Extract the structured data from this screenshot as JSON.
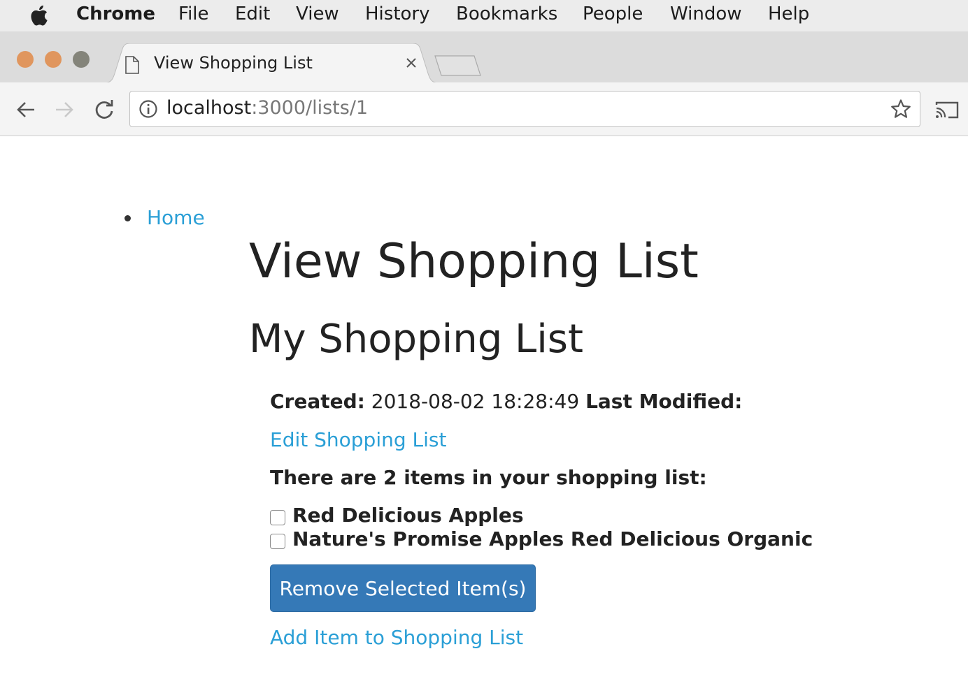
{
  "menubar": {
    "app_name": "Chrome",
    "items": [
      "File",
      "Edit",
      "View",
      "History",
      "Bookmarks",
      "People",
      "Window",
      "Help"
    ]
  },
  "browser": {
    "tab_title": "View Shopping List",
    "url_host": "localhost",
    "url_rest": ":3000/lists/1"
  },
  "page": {
    "nav": {
      "home": "Home"
    },
    "title": "View Shopping List",
    "list_name": "My Shopping List",
    "created_label": "Created:",
    "created_value": "2018-08-02 18:28:49",
    "modified_label": "Last Modified:",
    "edit_link": "Edit Shopping List",
    "count_text": "There are 2 items in your shopping list:",
    "items": [
      {
        "label": "Red Delicious Apples",
        "checked": false
      },
      {
        "label": "Nature's Promise Apples Red Delicious Organic",
        "checked": false
      }
    ],
    "remove_button": "Remove Selected Item(s)",
    "add_link": "Add Item to Shopping List"
  },
  "colors": {
    "link": "#2a9fd6",
    "primary_button": "#3579b7"
  }
}
